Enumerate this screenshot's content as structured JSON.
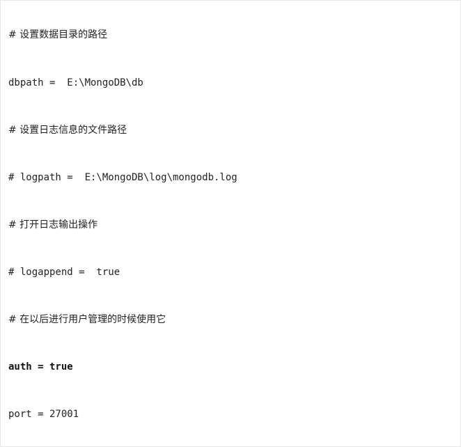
{
  "config_lines": [
    "# 设置数据目录的路径",
    "dbpath =  E:\\MongoDB\\db",
    "# 设置日志信息的文件路径",
    "# logpath =  E:\\MongoDB\\log\\mongodb.log",
    "# 打开日志输出操作",
    "# logappend =  true",
    "# 在以后进行用户管理的时候使用它",
    "auth = true",
    "port = 27001"
  ]
}
